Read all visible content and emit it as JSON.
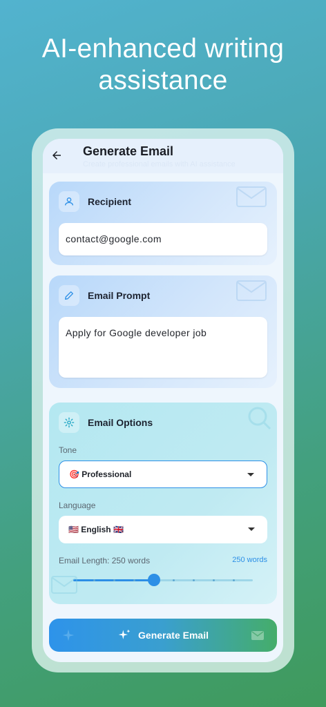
{
  "headline": "AI-enhanced writing assistance",
  "appbar": {
    "title": "Generate Email",
    "subtitle": "Create professional emails with AI assistance"
  },
  "recipient": {
    "label": "Recipient",
    "value": "contact@google.com"
  },
  "prompt": {
    "label": "Email Prompt",
    "value": "Apply for Google developer job"
  },
  "options": {
    "label": "Email Options",
    "tone_label": "Tone",
    "tone_value": "🎯 Professional",
    "language_label": "Language",
    "language_value": "🇺🇸 English 🇬🇧",
    "length_label": "Email Length: 250 words",
    "length_badge": "250 words",
    "length_fraction": 0.45
  },
  "generate_button": {
    "label": "Generate Email"
  },
  "colors": {
    "accent": "#2c8fe6",
    "button_start": "#2e93ea",
    "button_end": "#45ad6a"
  }
}
